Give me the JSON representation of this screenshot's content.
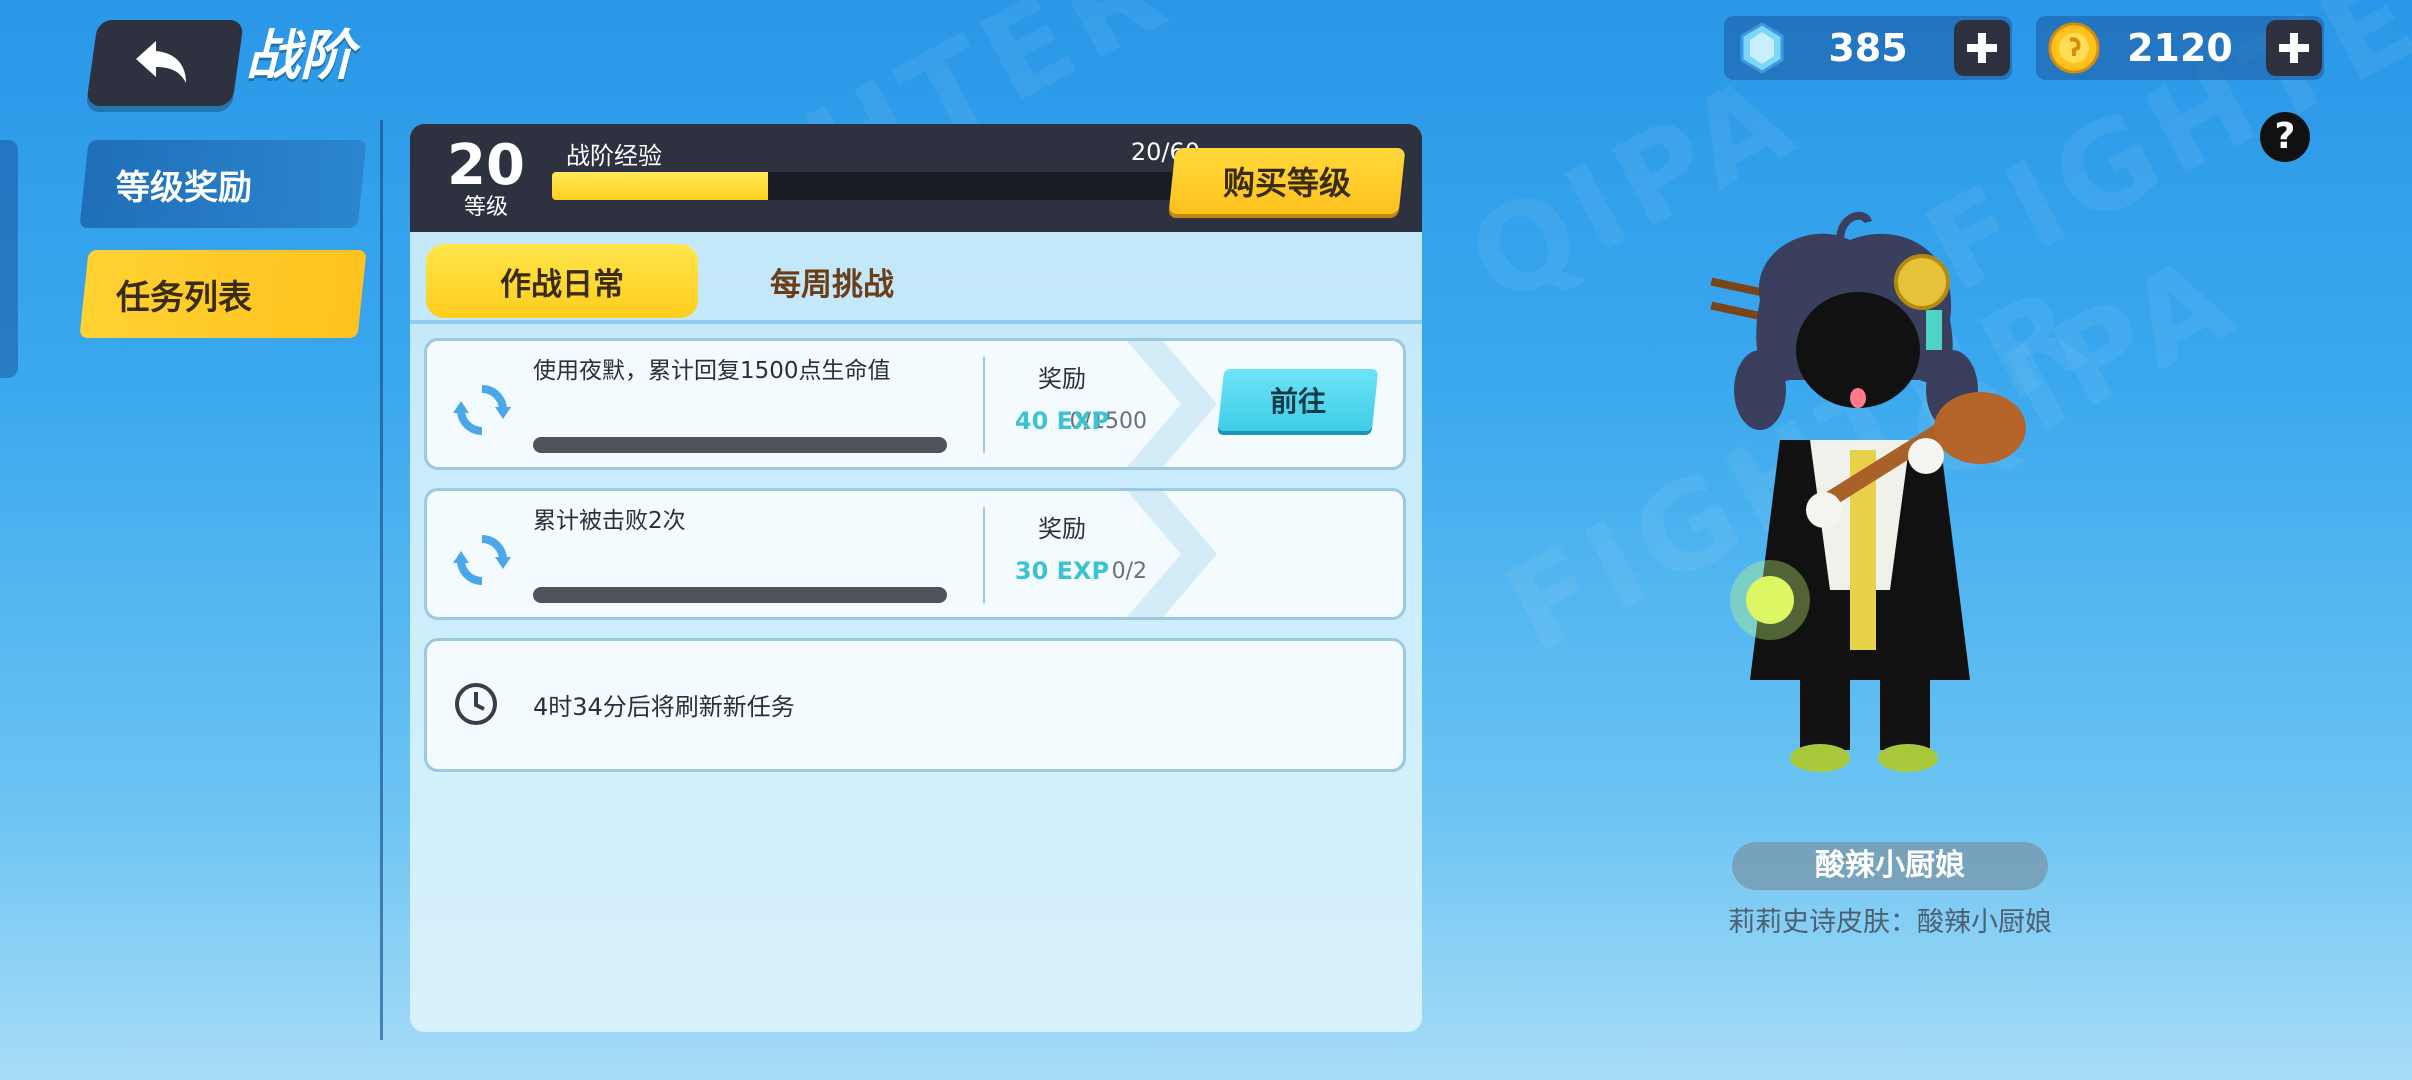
{
  "header": {
    "title": "战阶",
    "gems": "385",
    "coins": "2120",
    "help": "?"
  },
  "sidebar": {
    "items": [
      {
        "label": "等级奖励"
      },
      {
        "label": "任务列表"
      }
    ]
  },
  "pass": {
    "level": "20",
    "level_label": "等级",
    "exp_label": "战阶经验",
    "exp_count": "20/60",
    "exp_progress": 0.333,
    "buy_label": "购买等级"
  },
  "tabs": [
    {
      "label": "作战日常"
    },
    {
      "label": "每周挑战"
    }
  ],
  "tasks": [
    {
      "text": "使用夜默，累计回复1500点生命值",
      "count": "0/1500",
      "progress": 0,
      "reward_label": "奖励",
      "reward": "40 EXP",
      "action": "前往"
    },
    {
      "text": "累计被击败2次",
      "count": "0/2",
      "progress": 0,
      "reward_label": "奖励",
      "reward": "30 EXP"
    }
  ],
  "refresh_note": "4时34分后将刷新新任务",
  "showcase": {
    "skin_name": "酸辣小厨娘",
    "skin_desc": "莉莉史诗皮肤：酸辣小厨娘"
  }
}
